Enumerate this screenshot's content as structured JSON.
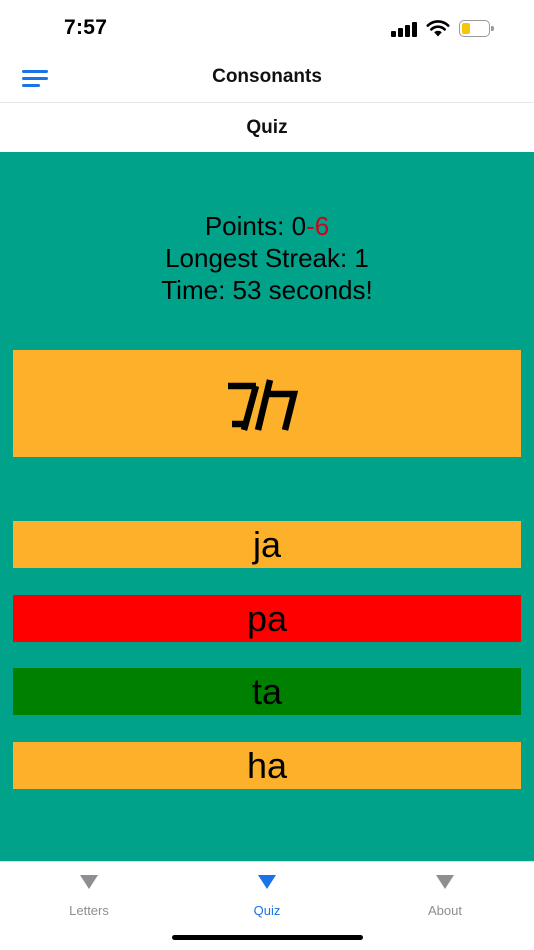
{
  "status_bar": {
    "time": "7:57",
    "battery_level": 0.25
  },
  "nav": {
    "title": "Consonants",
    "menu_icon": "hamburger-menu-icon"
  },
  "subheader": {
    "title": "Quiz"
  },
  "stats": {
    "points_label": "Points: ",
    "points_value": "0",
    "points_negative": "-6",
    "streak": "Longest Streak: 1",
    "time": "Time: 53 seconds!"
  },
  "prompt": {
    "glyph_name": "script-letter-glyph"
  },
  "answers": [
    {
      "label": "ja",
      "state": "neutral",
      "color": "#fdb12a"
    },
    {
      "label": "pa",
      "state": "wrong",
      "color": "#ff0000"
    },
    {
      "label": "ta",
      "state": "correct",
      "color": "#008000"
    },
    {
      "label": "ha",
      "state": "neutral",
      "color": "#fdb12a"
    }
  ],
  "tabs": [
    {
      "label": "Letters",
      "icon": "triangle-down-icon",
      "active": false
    },
    {
      "label": "Quiz",
      "icon": "triangle-down-icon",
      "active": true
    },
    {
      "label": "About",
      "icon": "triangle-down-icon",
      "active": false
    }
  ],
  "colors": {
    "accent": "#1a73e8",
    "quiz_background": "#00a28a",
    "card": "#fdb12a",
    "negative": "#d0021b"
  }
}
